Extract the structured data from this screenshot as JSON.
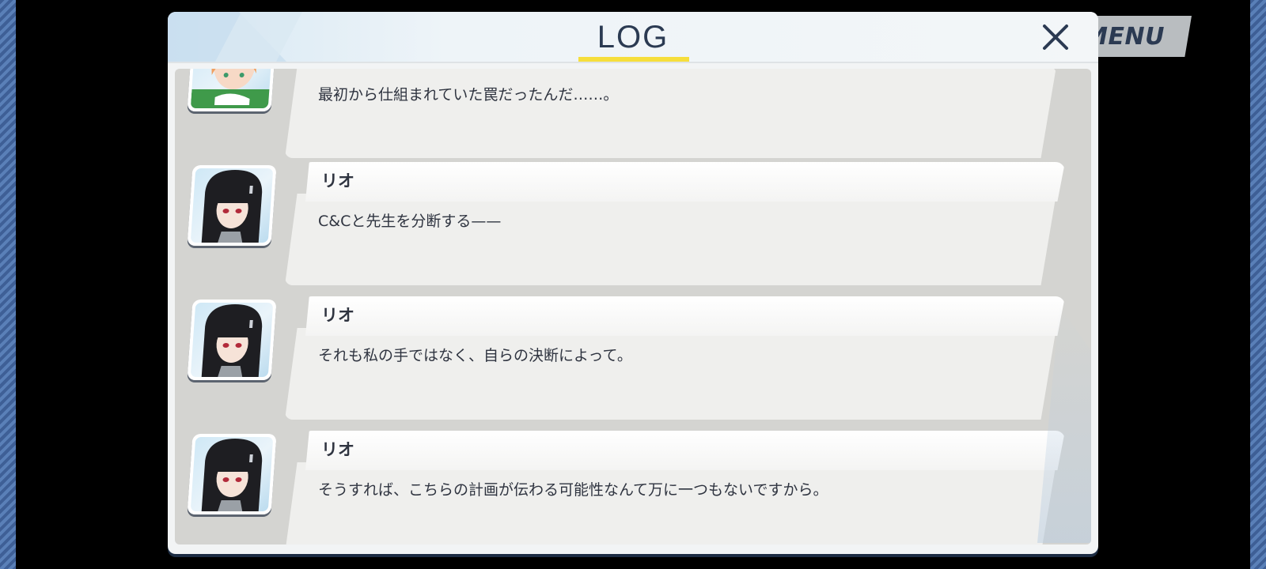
{
  "header": {
    "title": "LOG",
    "close_icon": "close-icon",
    "menu_label": "MENU"
  },
  "log": {
    "entries": [
      {
        "speaker": "",
        "text": "最初から仕組まれていた罠だったんだ……。",
        "portrait": "orange-haired-girl-portrait"
      },
      {
        "speaker": "リオ",
        "text": "C&Cと先生を分断する——",
        "portrait": "black-haired-girl-portrait"
      },
      {
        "speaker": "リオ",
        "text": "それも私の手ではなく、自らの決断によって。",
        "portrait": "black-haired-girl-portrait"
      },
      {
        "speaker": "リオ",
        "text": "そうすれば、こちらの計画が伝わる可能性なんて万に一つもないですから。",
        "portrait": "black-haired-girl-portrait"
      }
    ]
  },
  "colors": {
    "accent_underline": "#f6de3c",
    "title_text": "#2b3a52",
    "side_stripe": "#4a6ea8"
  }
}
